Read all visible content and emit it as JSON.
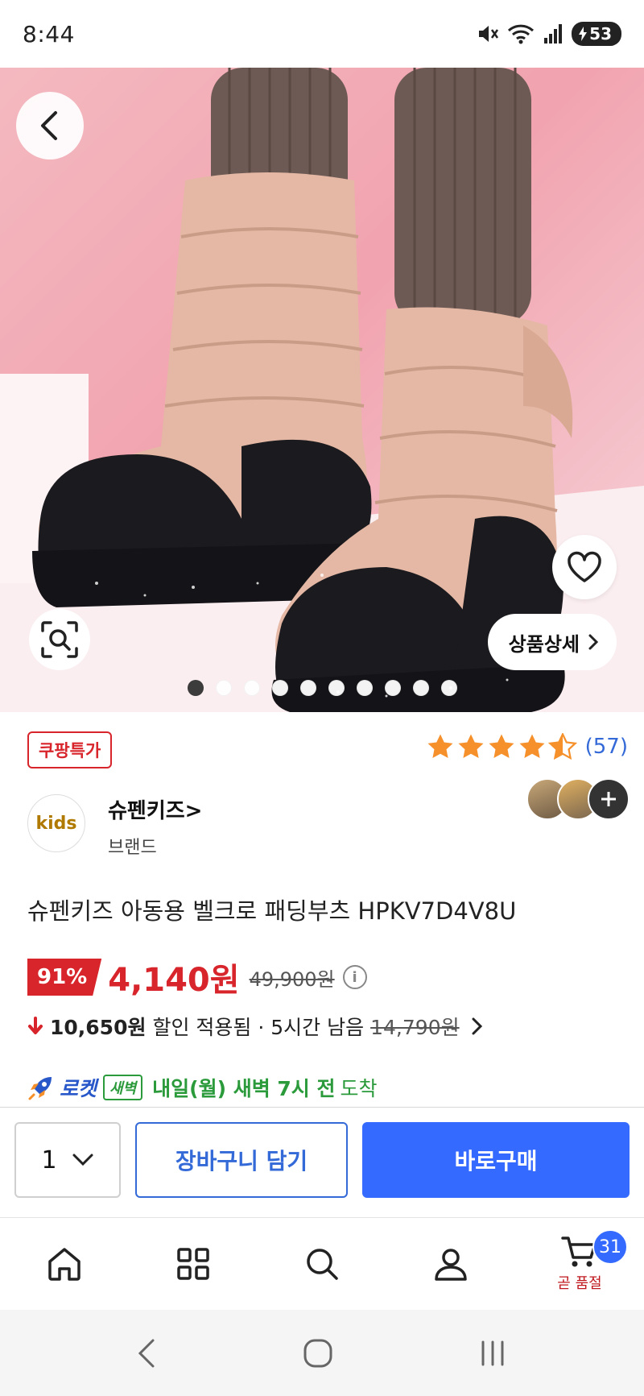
{
  "status_bar": {
    "time": "8:44",
    "battery": "53"
  },
  "hero": {
    "detail_button": "상품상세",
    "dots_total": 10,
    "dots_active": 0
  },
  "product": {
    "deal_badge": "쿠팡특가",
    "rating_stars": 4.5,
    "rating_count": "(57)",
    "brand_logo_text": "kids",
    "brand_name": "슈펜키즈>",
    "brand_sub": "브랜드",
    "title": "슈펜키즈 아동용 벨크로 패딩부츠 HPKV7D4V8U",
    "discount": "91%",
    "sale_price": "4,140원",
    "original_price": "49,900원",
    "coupon_amount": "10,650원",
    "coupon_text": "할인 적용됨 · 5시간 남음",
    "coupon_strike": "14,790원",
    "delivery_rocket": "로켓",
    "delivery_badge": "새벽",
    "delivery_text": "내일(월) 새벽 7시 전",
    "delivery_suffix": "도착"
  },
  "purchase": {
    "quantity": "1",
    "cart_label": "장바구니 담기",
    "buy_label": "바로구매"
  },
  "bottom_nav": {
    "cart_count": "31",
    "cart_caption": "곧 품절"
  },
  "colors": {
    "accent_red": "#d8242b",
    "accent_blue": "#346aff",
    "rating_orange": "#f5902b",
    "delivery_green": "#2a9a3b"
  }
}
